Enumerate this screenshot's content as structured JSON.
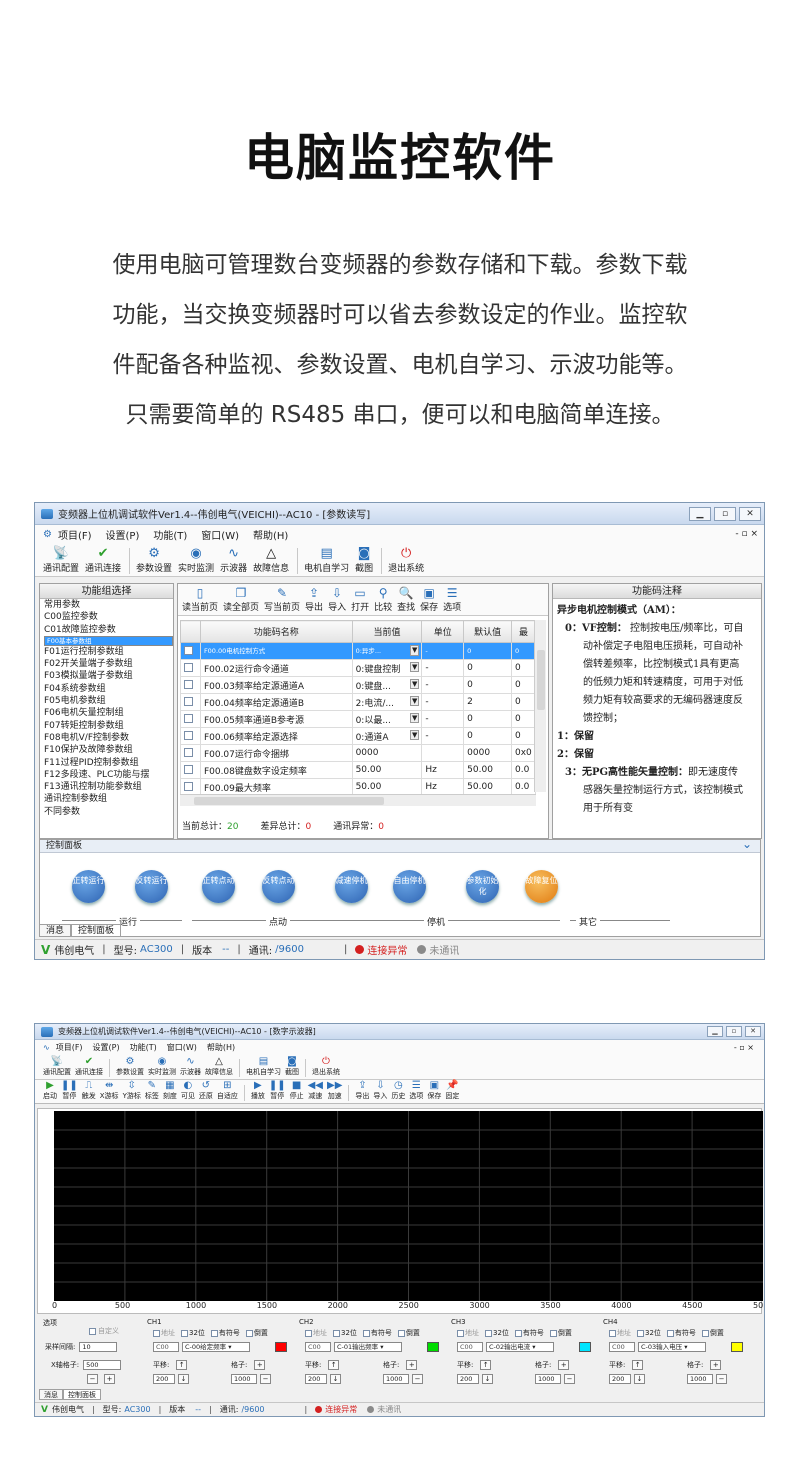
{
  "page": {
    "title": "电脑监控软件",
    "intro_lines": [
      "使用电脑可管理数台变频器的参数存储和下载。参数下载",
      "功能，当交换变频器时可以省去参数设定的作业。监控软",
      "件配备各种监视、参数设置、电机自学习、示波功能等。",
      "只需要简单的 RS485 串口，便可以和电脑简单连接。"
    ]
  },
  "win1": {
    "title": "变频器上位机调试软件Ver1.4--伟创电气(VEICHI)--AC10 - [参数读写]",
    "menu": [
      "项目(F)",
      "设置(P)",
      "功能(T)",
      "窗口(W)",
      "帮助(H)"
    ],
    "menu_right": "- ▫ ×",
    "toolbar": [
      "通讯配置",
      "通讯连接",
      "参数设置",
      "实时监测",
      "示波器",
      "故障信息",
      "电机自学习",
      "截图",
      "退出系统"
    ],
    "left_header": "功能组选择",
    "groups": [
      "常用参数",
      "C00监控参数",
      "C01故障监控参数",
      "F00基本参数组",
      "F01运行控制参数组",
      "F02开关量端子参数组",
      "F03模拟量端子参数组",
      "F04系统参数组",
      "F05电机参数组",
      "F06电机矢量控制组",
      "F07转矩控制参数组",
      "F08电机V/F控制参数",
      "F10保护及故障参数组",
      "F11过程PID控制参数组",
      "F12多段速、PLC功能与摆",
      "F13通讯控制功能参数组",
      "通讯控制参数组",
      "不同参数"
    ],
    "center_tools": [
      "读当前页",
      "读全部页",
      "写当前页",
      "导出",
      "导入",
      "打开",
      "比较",
      "查找",
      "保存",
      "选项"
    ],
    "columns": [
      "功能码名称",
      "当前值",
      "单位",
      "默认值",
      "最"
    ],
    "rows": [
      {
        "name": "F00.00电机控制方式",
        "value": "0:异步...",
        "unit": "-",
        "default": "0",
        "max": "0"
      },
      {
        "name": "F00.02运行命令通道",
        "value": "0:键盘控制",
        "unit": "-",
        "default": "0",
        "max": "0"
      },
      {
        "name": "F00.03频率给定源通道A",
        "value": "0:键盘...",
        "unit": "-",
        "default": "0",
        "max": "0"
      },
      {
        "name": "F00.04频率给定源通道B",
        "value": "2:电流/...",
        "unit": "-",
        "default": "2",
        "max": "0"
      },
      {
        "name": "F00.05频率通道B参考源",
        "value": "0:以最...",
        "unit": "-",
        "default": "0",
        "max": "0"
      },
      {
        "name": "F00.06频率给定源选择",
        "value": "0:通道A",
        "unit": "-",
        "default": "0",
        "max": "0"
      },
      {
        "name": "F00.07运行命令捆绑",
        "value": "0000",
        "unit": "",
        "default": "0000",
        "max": "0x0"
      },
      {
        "name": "F00.08键盘数字设定频率",
        "value": "50.00",
        "unit": "Hz",
        "default": "50.00",
        "max": "0.0"
      },
      {
        "name": "F00.09最大频率",
        "value": "50.00",
        "unit": "Hz",
        "default": "50.00",
        "max": "0.0"
      }
    ],
    "status": {
      "total_label": "当前总计：",
      "total": "20",
      "diff_label": "差异总计：",
      "diff": "0",
      "err_label": "通讯异常：",
      "err": "0"
    },
    "note_header": "功能码注释",
    "note_title": "异步电机控制模式（AM）：",
    "note_items": [
      {
        "k": "0：",
        "b": "VF控制：",
        "t": "控制按电压/频率比，可自动补偿定子电阻电压损耗，可自动补偿转差频率，比控制模式1具有更高的低频力矩和转速精度，可用于对低频力矩有较高要求的无编码器速度反馈控制；"
      },
      {
        "k": "1：",
        "b": "保留",
        "t": ""
      },
      {
        "k": "2：",
        "b": "保留",
        "t": ""
      },
      {
        "k": "3：",
        "b": "无PG高性能矢量控制：",
        "t": "即无速度传感器矢量控制运行方式，该控制模式用于所有变"
      }
    ],
    "ctrl_header": "控制面板",
    "ctrl_buttons": [
      "正转运行",
      "反转运行",
      "正转点动",
      "反转点动",
      "减速停机",
      "自由停机",
      "参数初始化",
      "故障复位"
    ],
    "ctrl_groups": [
      "运行",
      "点动",
      "停机",
      "其它"
    ],
    "tabs": [
      "消息",
      "控制面板"
    ],
    "statusbar": {
      "brand": "伟创电气",
      "model_label": "型号:",
      "model": "AC300",
      "ver_label": "版本",
      "ver": "--",
      "comm_label": "通讯:",
      "comm": "/9600",
      "conn": "连接异常",
      "nocomm": "未通讯"
    }
  },
  "win2": {
    "title": "变频器上位机调试软件Ver1.4--伟创电气(VEICHI)--AC10 - [数字示波器]",
    "menu": [
      "项目(F)",
      "设置(P)",
      "功能(T)",
      "窗口(W)",
      "帮助(H)"
    ],
    "menu_right": "- ▫ ×",
    "toolbar": [
      "通讯配置",
      "通讯连接",
      "参数设置",
      "实时监测",
      "示波器",
      "故障信息",
      "电机自学习",
      "截图",
      "退出系统"
    ],
    "scope_tools": [
      "启动",
      "暂停",
      "触发",
      "X游标",
      "Y游标",
      "标签",
      "刻度",
      "可见",
      "还原",
      "自适应",
      "播放",
      "暂停",
      "停止",
      "减速",
      "加速",
      "导出",
      "导入",
      "历史",
      "选项",
      "保存",
      "固定"
    ],
    "x_ticks": [
      "0",
      "500",
      "1000",
      "1500",
      "2000",
      "2500",
      "3000",
      "3500",
      "4000",
      "4500",
      "50"
    ],
    "options": {
      "title": "选项",
      "auto": "自定义",
      "interval_label": "采样间隔:",
      "interval": "10",
      "grid_label": "X轴格子:",
      "grid": "500"
    },
    "channels": [
      {
        "name": "CH1",
        "code": "C00",
        "sig": "C-00给定频率",
        "color": "#ff0000"
      },
      {
        "name": "CH2",
        "code": "C00",
        "sig": "C-01输出频率",
        "color": "#00dd00"
      },
      {
        "name": "CH3",
        "code": "C00",
        "sig": "C-02输出电流",
        "color": "#00e5ff"
      },
      {
        "name": "CH4",
        "code": "C00",
        "sig": "C-03输入电压",
        "color": "#ffff00"
      }
    ],
    "ch_flags": [
      "地址",
      "32位",
      "有符号",
      "倒置"
    ],
    "shift_label": "平移:",
    "shift": "200",
    "scale_label": "格子:",
    "scale": "1000",
    "tabs": [
      "消息",
      "控制面板"
    ],
    "statusbar": {
      "brand": "伟创电气",
      "model_label": "型号:",
      "model": "AC300",
      "ver_label": "版本",
      "ver": "--",
      "comm_label": "通讯:",
      "comm": "/9600",
      "conn": "连接异常",
      "nocomm": "未通讯"
    }
  }
}
